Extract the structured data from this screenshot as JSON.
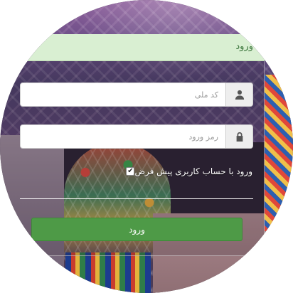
{
  "panel": {
    "title": "ورود"
  },
  "form": {
    "username": {
      "value": "",
      "placeholder": "کد ملی",
      "icon": "user-icon"
    },
    "password": {
      "value": "",
      "placeholder": "رمز ورود",
      "icon": "lock-icon"
    },
    "remember": {
      "checked": true,
      "label": "ورود با حساب کاربری پیش فرض"
    },
    "submit_label": "ورود"
  },
  "colors": {
    "header_bg": "#d9efd2",
    "header_text": "#3c763d",
    "button_bg": "#4e9a47"
  }
}
